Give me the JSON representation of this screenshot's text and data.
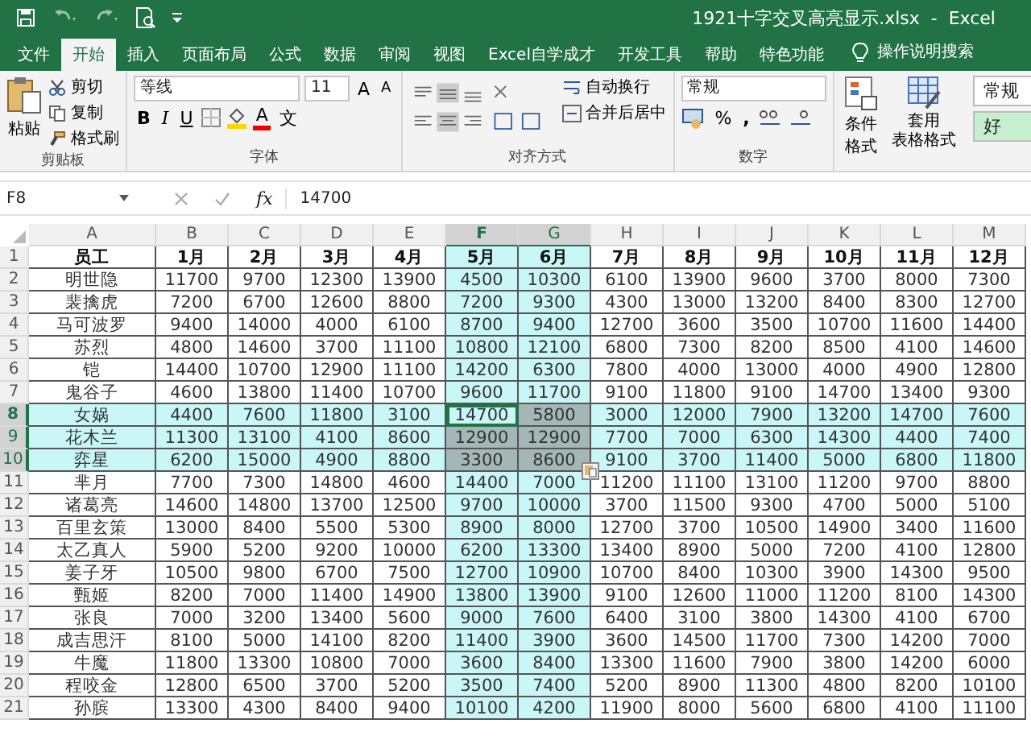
{
  "window": {
    "title": "1921十字交叉高亮显示.xlsx  -  Excel"
  },
  "tabs": [
    {
      "label": "文件",
      "selected": false
    },
    {
      "label": "开始",
      "selected": true
    },
    {
      "label": "插入",
      "selected": false
    },
    {
      "label": "页面布局",
      "selected": false
    },
    {
      "label": "公式",
      "selected": false
    },
    {
      "label": "数据",
      "selected": false
    },
    {
      "label": "审阅",
      "selected": false
    },
    {
      "label": "视图",
      "selected": false
    },
    {
      "label": "Excel自学成才",
      "selected": false
    },
    {
      "label": "开发工具",
      "selected": false
    },
    {
      "label": "帮助",
      "selected": false
    },
    {
      "label": "特色功能",
      "selected": false
    }
  ],
  "tell_me": "操作说明搜索",
  "clipboard": {
    "title": "剪贴板",
    "paste": "粘贴",
    "cut": "剪切",
    "copy": "复制",
    "format_painter": "格式刷"
  },
  "font": {
    "title": "字体",
    "font_name": "等线",
    "font_size": "11",
    "grow": "A",
    "shrink": "A",
    "bold": "B",
    "italic": "I",
    "underline": "U",
    "font_color": "A",
    "phonetic": "文"
  },
  "alignment": {
    "title": "对齐方式",
    "wrap_text": "自动换行",
    "merge_center": "合并后居中"
  },
  "number": {
    "title": "数字",
    "format": "常规",
    "percent": "%",
    "comma": ","
  },
  "styles": {
    "conditional_formatting": "条件格式",
    "format_as_table": [
      "套用",
      "表格格式"
    ],
    "cell_styles": [
      {
        "label": "常规",
        "color": "#ffffff"
      },
      {
        "label": "好",
        "color": "#c6efce"
      }
    ]
  },
  "formula_bar": {
    "name_box": "F8",
    "fx": "fx",
    "formula": "14700"
  },
  "sheet": {
    "columns": [
      {
        "letter": "A",
        "highlighted": false,
        "selected": false,
        "active": false
      },
      {
        "letter": "B",
        "highlighted": false,
        "selected": false,
        "active": false
      },
      {
        "letter": "C",
        "highlighted": false,
        "selected": false,
        "active": false
      },
      {
        "letter": "D",
        "highlighted": false,
        "selected": false,
        "active": false
      },
      {
        "letter": "E",
        "highlighted": false,
        "selected": false,
        "active": false
      },
      {
        "letter": "F",
        "highlighted": true,
        "selected": true,
        "active": true
      },
      {
        "letter": "G",
        "highlighted": true,
        "selected": true,
        "active": false
      },
      {
        "letter": "H",
        "highlighted": false,
        "selected": false,
        "active": false
      },
      {
        "letter": "I",
        "highlighted": false,
        "selected": false,
        "active": false
      },
      {
        "letter": "J",
        "highlighted": false,
        "selected": false,
        "active": false
      },
      {
        "letter": "K",
        "highlighted": false,
        "selected": false,
        "active": false
      },
      {
        "letter": "L",
        "highlighted": false,
        "selected": false,
        "active": false
      },
      {
        "letter": "M",
        "highlighted": false,
        "selected": false,
        "active": false
      }
    ],
    "rows": [
      {
        "number": "1",
        "kind": "header",
        "highlighted": false,
        "selected": false,
        "active": false,
        "cells": [
          "员工",
          "1月",
          "2月",
          "3月",
          "4月",
          "5月",
          "6月",
          "7月",
          "8月",
          "9月",
          "10月",
          "11月",
          "12月"
        ]
      },
      {
        "number": "2",
        "kind": "data",
        "highlighted": false,
        "selected": false,
        "active": false,
        "cells": [
          "明世隐",
          "11700",
          "9700",
          "12300",
          "13900",
          "4500",
          "10300",
          "6100",
          "13900",
          "9600",
          "3700",
          "8000",
          "7300"
        ]
      },
      {
        "number": "3",
        "kind": "data",
        "highlighted": false,
        "selected": false,
        "active": false,
        "cells": [
          "裴擒虎",
          "7200",
          "6700",
          "12600",
          "8800",
          "7200",
          "9300",
          "4300",
          "13000",
          "13200",
          "8400",
          "8300",
          "12700"
        ]
      },
      {
        "number": "4",
        "kind": "data",
        "highlighted": false,
        "selected": false,
        "active": false,
        "cells": [
          "马可波罗",
          "9400",
          "14000",
          "4000",
          "6100",
          "8700",
          "9400",
          "12700",
          "3600",
          "3500",
          "10700",
          "11600",
          "14400"
        ]
      },
      {
        "number": "5",
        "kind": "data",
        "highlighted": false,
        "selected": false,
        "active": false,
        "cells": [
          "苏烈",
          "4800",
          "14600",
          "3700",
          "11100",
          "10800",
          "12100",
          "6800",
          "7300",
          "8200",
          "8500",
          "4100",
          "14600"
        ]
      },
      {
        "number": "6",
        "kind": "data",
        "highlighted": false,
        "selected": false,
        "active": false,
        "cells": [
          "铠",
          "14400",
          "10700",
          "12900",
          "11100",
          "14200",
          "6300",
          "7800",
          "4000",
          "13000",
          "4000",
          "4900",
          "12800"
        ]
      },
      {
        "number": "7",
        "kind": "data",
        "highlighted": false,
        "selected": false,
        "active": false,
        "cells": [
          "鬼谷子",
          "4600",
          "13800",
          "11400",
          "10700",
          "9600",
          "11700",
          "9100",
          "11800",
          "9100",
          "14700",
          "13400",
          "9300"
        ]
      },
      {
        "number": "8",
        "kind": "data",
        "highlighted": true,
        "selected": true,
        "active": true,
        "cells": [
          "女娲",
          "4400",
          "7600",
          "11800",
          "3100",
          "14700",
          "5800",
          "3000",
          "12000",
          "7900",
          "13200",
          "14700",
          "7600"
        ]
      },
      {
        "number": "9",
        "kind": "data",
        "highlighted": true,
        "selected": true,
        "active": false,
        "cells": [
          "花木兰",
          "11300",
          "13100",
          "4100",
          "8600",
          "12900",
          "12900",
          "7700",
          "7000",
          "6300",
          "14300",
          "4400",
          "7400"
        ]
      },
      {
        "number": "10",
        "kind": "data",
        "highlighted": true,
        "selected": true,
        "active": false,
        "cells": [
          "弈星",
          "6200",
          "15000",
          "4900",
          "8800",
          "3300",
          "8600",
          "9100",
          "3700",
          "11400",
          "5000",
          "6800",
          "11800"
        ]
      },
      {
        "number": "11",
        "kind": "data",
        "highlighted": false,
        "selected": false,
        "active": false,
        "cells": [
          "芈月",
          "7700",
          "7300",
          "14800",
          "4600",
          "14400",
          "7000",
          "11200",
          "11100",
          "13100",
          "11200",
          "9700",
          "8800"
        ]
      },
      {
        "number": "12",
        "kind": "data",
        "highlighted": false,
        "selected": false,
        "active": false,
        "cells": [
          "诸葛亮",
          "14600",
          "14800",
          "13700",
          "12500",
          "9700",
          "10000",
          "3700",
          "11500",
          "9300",
          "4700",
          "5000",
          "5100"
        ]
      },
      {
        "number": "13",
        "kind": "data",
        "highlighted": false,
        "selected": false,
        "active": false,
        "cells": [
          "百里玄策",
          "13000",
          "8400",
          "5500",
          "5300",
          "8900",
          "8000",
          "12700",
          "3700",
          "10500",
          "14900",
          "3400",
          "11600"
        ]
      },
      {
        "number": "14",
        "kind": "data",
        "highlighted": false,
        "selected": false,
        "active": false,
        "cells": [
          "太乙真人",
          "5900",
          "5200",
          "9200",
          "10000",
          "6200",
          "13300",
          "13400",
          "8900",
          "5000",
          "7200",
          "4100",
          "12800"
        ]
      },
      {
        "number": "15",
        "kind": "data",
        "highlighted": false,
        "selected": false,
        "active": false,
        "cells": [
          "姜子牙",
          "10500",
          "9800",
          "6700",
          "7500",
          "12700",
          "10900",
          "10700",
          "8400",
          "10300",
          "3900",
          "14300",
          "9500"
        ]
      },
      {
        "number": "16",
        "kind": "data",
        "highlighted": false,
        "selected": false,
        "active": false,
        "cells": [
          "甄姬",
          "8200",
          "7000",
          "11400",
          "14900",
          "13800",
          "13900",
          "9100",
          "12600",
          "11000",
          "11200",
          "8100",
          "14300"
        ]
      },
      {
        "number": "17",
        "kind": "data",
        "highlighted": false,
        "selected": false,
        "active": false,
        "cells": [
          "张良",
          "7000",
          "3200",
          "13400",
          "5600",
          "9000",
          "7600",
          "6400",
          "3100",
          "3800",
          "14300",
          "4100",
          "6700"
        ]
      },
      {
        "number": "18",
        "kind": "data",
        "highlighted": false,
        "selected": false,
        "active": false,
        "cells": [
          "成吉思汗",
          "8100",
          "5000",
          "14100",
          "8200",
          "11400",
          "3900",
          "3600",
          "14500",
          "11700",
          "7300",
          "14200",
          "7000"
        ]
      },
      {
        "number": "19",
        "kind": "data",
        "highlighted": false,
        "selected": false,
        "active": false,
        "cells": [
          "牛魔",
          "11800",
          "13300",
          "10800",
          "7000",
          "3600",
          "8400",
          "13300",
          "11600",
          "7900",
          "3800",
          "14200",
          "6000"
        ]
      },
      {
        "number": "20",
        "kind": "data",
        "highlighted": false,
        "selected": false,
        "active": false,
        "cells": [
          "程咬金",
          "12800",
          "6500",
          "3700",
          "5200",
          "3500",
          "7400",
          "5200",
          "8900",
          "11300",
          "4800",
          "8200",
          "10100"
        ]
      },
      {
        "number": "21",
        "kind": "data",
        "highlighted": false,
        "selected": false,
        "active": false,
        "cells": [
          "孙膑",
          "13300",
          "4300",
          "8400",
          "9400",
          "10100",
          "4200",
          "11900",
          "8000",
          "5600",
          "6800",
          "4100",
          "11100"
        ]
      }
    ]
  }
}
